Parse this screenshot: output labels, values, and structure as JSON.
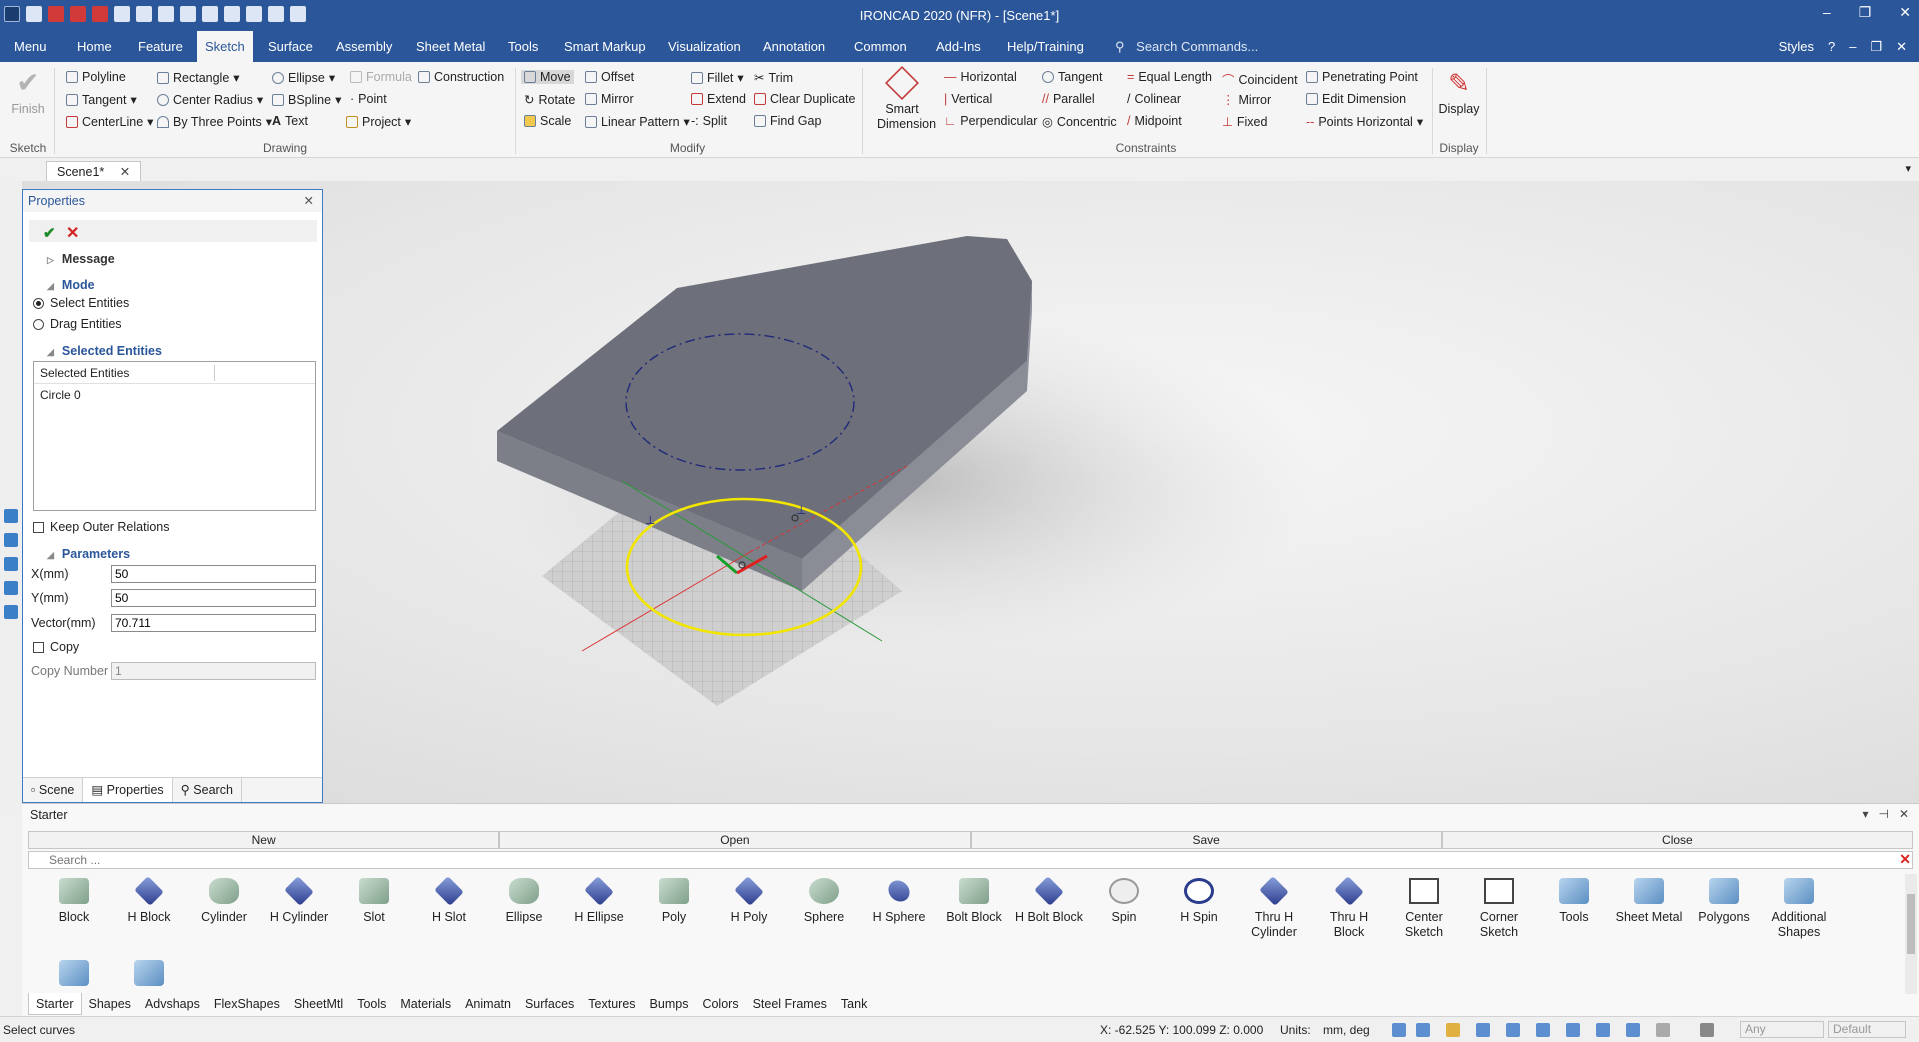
{
  "app": {
    "title": "IRONCAD 2020 (NFR) - [Scene1*]"
  },
  "window_controls": {
    "minimize": "–",
    "restore": "❐",
    "close": "✕"
  },
  "menu": {
    "tabs": [
      "Menu",
      "Home",
      "Feature",
      "Sketch",
      "Surface",
      "Assembly",
      "Sheet Metal",
      "Tools",
      "Smart Markup",
      "Visualization",
      "Annotation",
      "Common",
      "Add-Ins",
      "Help/Training"
    ],
    "active": "Sketch",
    "search_placeholder": "Search Commands...",
    "styles_label": "Styles"
  },
  "ribbon": {
    "sketch_group": {
      "finish": "Finish",
      "label": "Sketch"
    },
    "drawing": {
      "label": "Drawing",
      "items": [
        "Polyline",
        "Rectangle",
        "Ellipse",
        "Formula",
        "Construction",
        "Tangent",
        "Center Radius",
        "BSpline",
        "Point",
        "CenterLine",
        "By Three Points",
        "Text",
        "Project"
      ]
    },
    "modify": {
      "label": "Modify",
      "items": [
        "Move",
        "Offset",
        "Fillet",
        "Trim",
        "Rotate",
        "Mirror",
        "Extend",
        "Clear Duplicate",
        "Scale",
        "Linear Pattern",
        "Split",
        "Find Gap"
      ]
    },
    "constraints": {
      "label": "Constraints",
      "smart_dimension": "Smart Dimension",
      "items": [
        "Horizontal",
        "Tangent",
        "Equal Length",
        "Coincident",
        "Penetrating Point",
        "Vertical",
        "Parallel",
        "Colinear",
        "Mirror",
        "Edit Dimension",
        "Perpendicular",
        "Concentric",
        "Midpoint",
        "Fixed",
        "Points Horizontal"
      ]
    },
    "display": {
      "label": "Display",
      "button": "Display"
    }
  },
  "doc_tab": {
    "label": "Scene1*",
    "close": "✕"
  },
  "properties": {
    "title": "Properties",
    "close": "✕",
    "ok": "✔",
    "cancel": "✕",
    "message_label": "Message",
    "mode_label": "Mode",
    "mode_options": [
      "Select Entities",
      "Drag Entities"
    ],
    "mode_selected": "Select Entities",
    "selected_entities_label": "Selected Entities",
    "list_header": "Selected Entities",
    "list_items": [
      "Circle 0"
    ],
    "keep_outer_relations": "Keep Outer Relations",
    "parameters_label": "Parameters",
    "x_label": "X(mm)",
    "x_value": "50",
    "y_label": "Y(mm)",
    "y_value": "50",
    "vector_label": "Vector(mm)",
    "vector_value": "70.711",
    "copy_label": "Copy",
    "copy_number_label": "Copy Number",
    "copy_number_value": "1",
    "tabs": [
      "Scene",
      "Properties",
      "Search"
    ],
    "active_tab": "Properties"
  },
  "catalog": {
    "title": "Starter",
    "buttons": [
      "New",
      "Open",
      "Save",
      "Close"
    ],
    "search_placeholder": "Search ...",
    "items": [
      "Block",
      "H Block",
      "Cylinder",
      "H Cylinder",
      "Slot",
      "H Slot",
      "Ellipse",
      "H Ellipse",
      "Poly",
      "H Poly",
      "Sphere",
      "H Sphere",
      "Bolt Block",
      "H Bolt Block",
      "Spin",
      "H Spin",
      "Thru H Cylinder",
      "Thru H Block",
      "Center Sketch",
      "Corner Sketch",
      "Tools",
      "Sheet Metal",
      "Polygons",
      "Additional Shapes"
    ],
    "tabs": [
      "Starter",
      "Shapes",
      "Advshaps",
      "FlexShapes",
      "SheetMtl",
      "Tools",
      "Materials",
      "Animatn",
      "Surfaces",
      "Textures",
      "Bumps",
      "Colors",
      "Steel Frames",
      "Tank"
    ],
    "active_tab": "Starter"
  },
  "status": {
    "message": "Select curves",
    "coords": "X: -62.525 Y: 100.099 Z: 0.000",
    "units_label": "Units:",
    "units_value": "mm, deg",
    "filter_any": "Any",
    "filter_default": "Default"
  },
  "colors": {
    "title_bar": "#2b579a",
    "part_face": "#6d6f7a",
    "selected_circle": "#f2e600",
    "dashed_circle": "#1f2a7a"
  }
}
